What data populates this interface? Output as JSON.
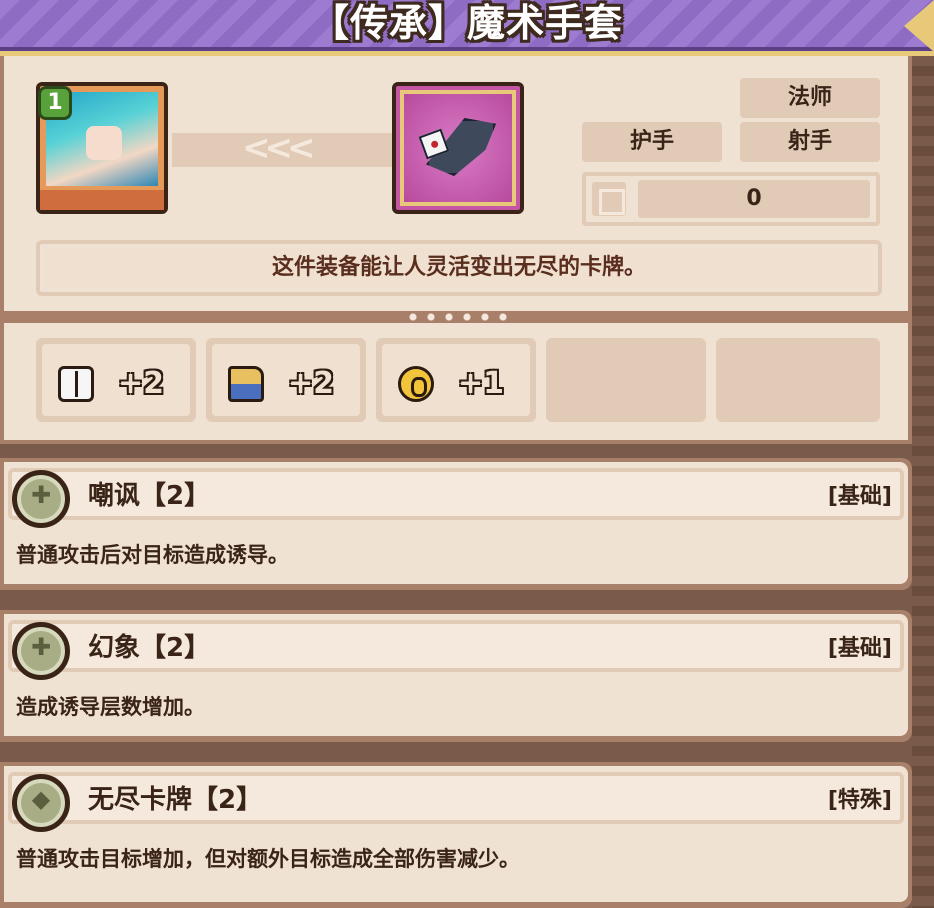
{
  "title": "【传承】魔术手套",
  "hero": {
    "level": "1"
  },
  "arrows": "<<<",
  "classes": {
    "mage": "法师",
    "guard": "护手",
    "archer": "射手"
  },
  "stat": {
    "value": "0"
  },
  "description": "这件装备能让人灵活变出无尽的卡牌。",
  "bonuses": [
    {
      "icon": "book-icon",
      "value": "+2"
    },
    {
      "icon": "boot-icon",
      "value": "+2"
    },
    {
      "icon": "shield-icon",
      "value": "+1"
    }
  ],
  "skills": [
    {
      "name": "嘲讽【2】",
      "type": "[基础]",
      "desc": "普通攻击后对目标造成诱导。"
    },
    {
      "name": "幻象【2】",
      "type": "[基础]",
      "desc": "造成诱导层数增加。"
    },
    {
      "name": "无尽卡牌【2】",
      "type": "[特殊]",
      "desc": "普通攻击目标增加，但对额外目标造成全部伤害减少。"
    }
  ]
}
